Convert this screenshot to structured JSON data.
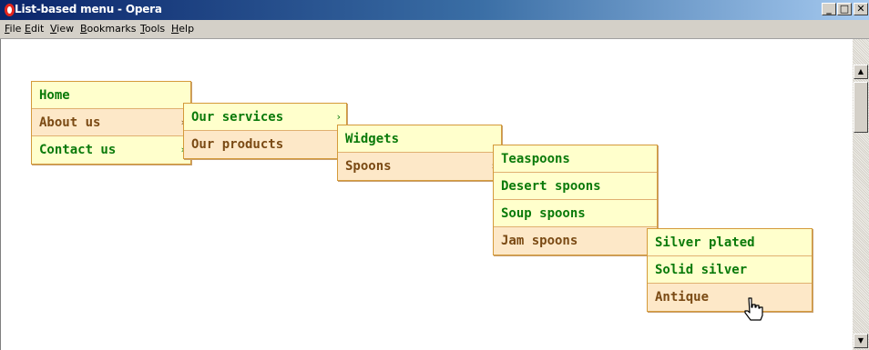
{
  "window": {
    "title": "List-based menu - Opera"
  },
  "window_controls": {
    "minimize": "_",
    "maximize": "□",
    "close": "✕"
  },
  "menubar": [
    "File",
    "Edit",
    "View",
    "Bookmarks",
    "Tools",
    "Help"
  ],
  "menus": [
    {
      "items": [
        {
          "label": "Home",
          "arrow": ""
        },
        {
          "label": "About us",
          "arrow": "›"
        },
        {
          "label": "Contact us",
          "arrow": "›"
        }
      ]
    },
    {
      "items": [
        {
          "label": "Our services",
          "arrow": "›"
        },
        {
          "label": "Our products",
          "arrow": "›"
        }
      ]
    },
    {
      "items": [
        {
          "label": "Widgets",
          "arrow": ""
        },
        {
          "label": "Spoons",
          "arrow": "›"
        }
      ]
    },
    {
      "items": [
        {
          "label": "Teaspoons",
          "arrow": ""
        },
        {
          "label": "Desert spoons",
          "arrow": ""
        },
        {
          "label": "Soup spoons",
          "arrow": ""
        },
        {
          "label": "Jam spoons",
          "arrow": "›"
        }
      ]
    },
    {
      "items": [
        {
          "label": "Silver plated",
          "arrow": ""
        },
        {
          "label": "Solid silver",
          "arrow": ""
        },
        {
          "label": "Antique",
          "arrow": ""
        }
      ]
    }
  ],
  "scrollbar": {
    "up_arrow": "▲",
    "down_arrow": "▼"
  },
  "colors": {
    "menu_bg": "#ffffcc",
    "menu_active_bg": "#fde8c8",
    "menu_text": "#0a7a0a",
    "menu_active_text": "#7a4a14",
    "menu_border": "#d49a3a"
  },
  "icons": {
    "browser": "opera-logo-icon",
    "cursor": "hand-pointer-icon"
  }
}
